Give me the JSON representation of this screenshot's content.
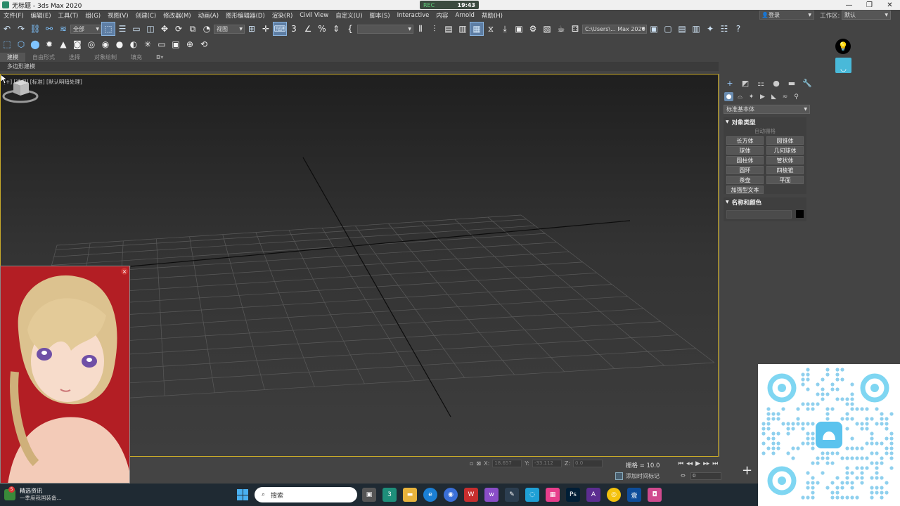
{
  "window": {
    "title": "无标题 - 3ds Max 2020",
    "controls": [
      "—",
      "❐",
      "✕"
    ]
  },
  "recorder": {
    "left": "REC",
    "time": "19:43"
  },
  "menu": [
    "文件(F)",
    "编辑(E)",
    "工具(T)",
    "组(G)",
    "视图(V)",
    "创建(C)",
    "修改器(M)",
    "动画(A)",
    "图形编辑器(D)",
    "渲染(R)",
    "Civil View",
    "自定义(U)",
    "脚本(S)",
    "Interactive",
    "内容",
    "Arnold",
    "帮助(H)"
  ],
  "account": {
    "login": "登录",
    "workspace_label": "工作区:",
    "workspace": "默认"
  },
  "toolbar": {
    "selection_filter": "全部",
    "ref_coord": "视图",
    "named_selection": "",
    "path": "C:\\Users\\... Max 2020"
  },
  "ribbon": {
    "tabs": [
      "建模",
      "自由形式",
      "选择",
      "对象绘制",
      "填充"
    ],
    "subtitle": "多边形建模"
  },
  "viewport": {
    "label": "[+] [透视] [标准] [默认明暗处理]"
  },
  "command_panel": {
    "category": "标准基本体",
    "object_type_title": "对象类型",
    "autogrid": "自动栅格",
    "buttons": [
      "长方体",
      "圆锥体",
      "球体",
      "几何球体",
      "圆柱体",
      "管状体",
      "圆环",
      "四棱锥",
      "茶壶",
      "平面",
      "加强型文本"
    ],
    "name_color_title": "名称和颜色",
    "object_color": "#000000"
  },
  "status": {
    "x_label": "X:",
    "x_value": "18.657",
    "y_label": "Y:",
    "y_value": "-33.112",
    "z_label": "Z:",
    "z_value": "0.0",
    "grid": "栅格 = 10.0",
    "add_time_tag": "添加时间标记",
    "frame": "0"
  },
  "taskbar": {
    "news_title": "精选资讯",
    "news_sub": "一季度我国装备...",
    "news_badge": "5",
    "search_placeholder": "搜索"
  },
  "colors": {
    "viewport_border": "#c9ab2a",
    "accent": "#49b9d9"
  }
}
